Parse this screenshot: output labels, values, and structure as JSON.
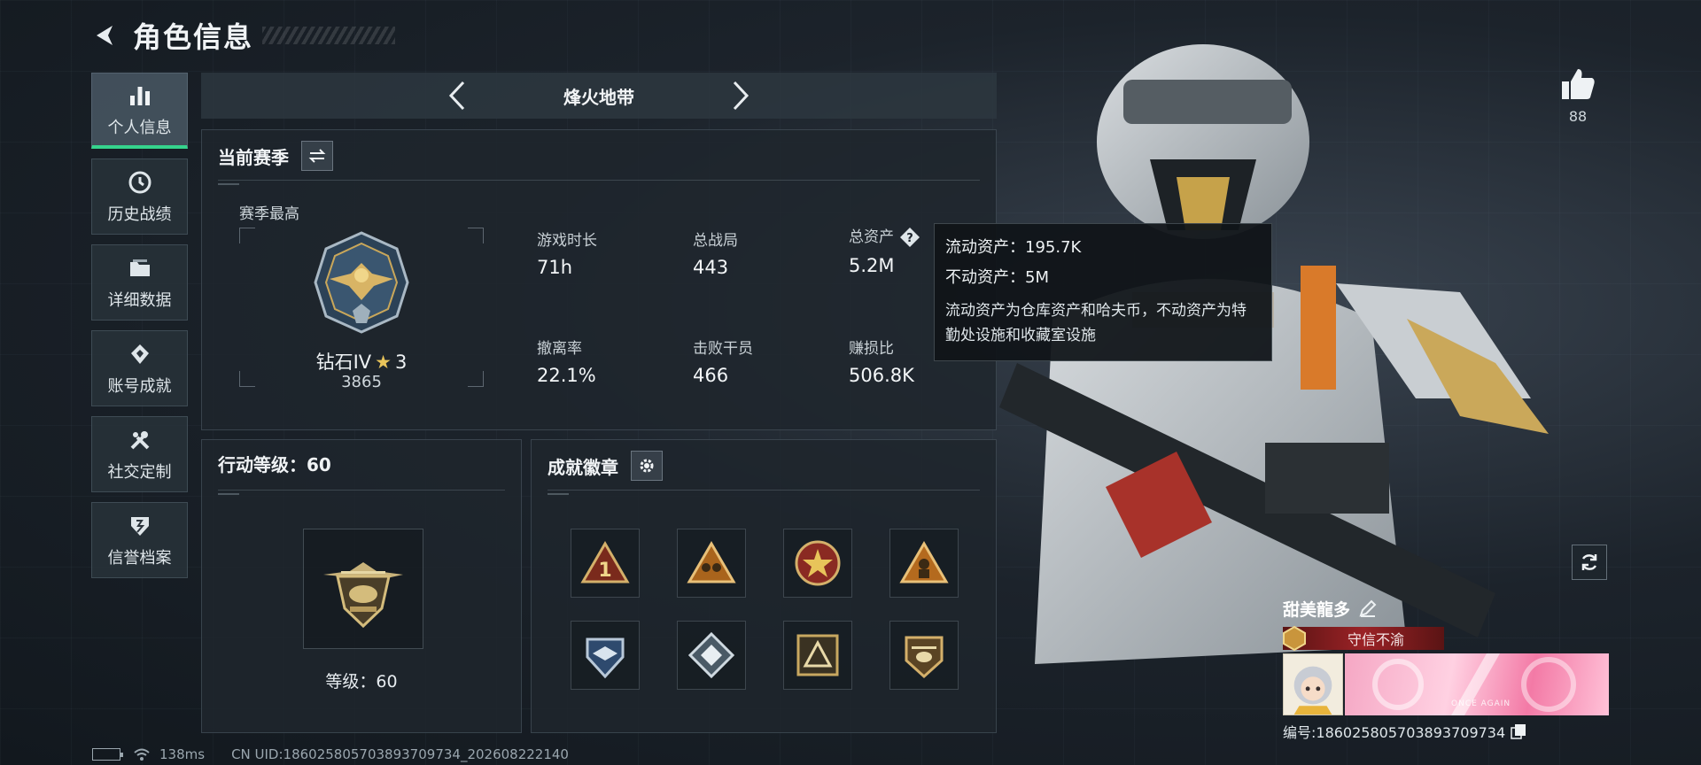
{
  "header": {
    "title": "角色信息"
  },
  "sidebar": {
    "items": [
      {
        "label": "个人信息",
        "icon": "bar-chart-icon",
        "active": true
      },
      {
        "label": "历史战绩",
        "icon": "clock-icon",
        "active": false
      },
      {
        "label": "详细数据",
        "icon": "folder-icon",
        "active": false
      },
      {
        "label": "账号成就",
        "icon": "achievement-icon",
        "active": false
      },
      {
        "label": "社交定制",
        "icon": "tools-icon",
        "active": false
      },
      {
        "label": "信誉档案",
        "icon": "shield-icon",
        "active": false
      }
    ]
  },
  "mode": {
    "title": "烽火地带"
  },
  "season": {
    "title": "当前赛季",
    "best_label": "赛季最高",
    "rank_name": "钻石IV",
    "rank_stars": "3",
    "rank_score": "3865",
    "stats": [
      {
        "label": "游戏时长",
        "value": "71h"
      },
      {
        "label": "总战局",
        "value": "443"
      },
      {
        "label": "总资产",
        "value": "5.2M"
      },
      {
        "label": "撤离率",
        "value": "22.1%"
      },
      {
        "label": "击败干员",
        "value": "466"
      },
      {
        "label": "赚损比",
        "value": "506.8K"
      }
    ]
  },
  "tooltip": {
    "liquid": "流动资产：195.7K",
    "fixed": "不动资产：5M",
    "desc": "流动资产为仓库资产和哈夫币，不动资产为特勤处设施和收藏室设施"
  },
  "action_level": {
    "title": "行动等级：60",
    "level_text": "等级：60"
  },
  "badges": {
    "title": "成就徽章",
    "items": [
      "rank-1-badge",
      "team-badge",
      "star-medal-badge",
      "soldier-badge",
      "eagle-shield-badge",
      "diamond-badge",
      "triangle-badge",
      "helicopter-badge"
    ]
  },
  "likes": {
    "count": "88"
  },
  "profile": {
    "name": "甜美龍多",
    "title": "守信不渝",
    "banner_text": "ONCE AGAIN",
    "uid": "编号:18602580570389370973​4"
  },
  "status": {
    "ping": "138ms",
    "uid_line": "CN UID:186025805703893709734_202608222140"
  },
  "colors": {
    "accent": "#35d48d",
    "title_bg": "#9b2226",
    "gold": "#e8c45a"
  }
}
